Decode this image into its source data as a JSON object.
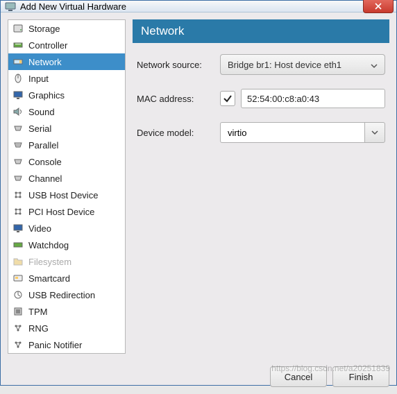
{
  "window": {
    "title": "Add New Virtual Hardware"
  },
  "sidebar": {
    "items": [
      {
        "label": "Storage",
        "icon": "storage-icon"
      },
      {
        "label": "Controller",
        "icon": "controller-icon"
      },
      {
        "label": "Network",
        "icon": "network-icon",
        "selected": true
      },
      {
        "label": "Input",
        "icon": "input-icon"
      },
      {
        "label": "Graphics",
        "icon": "graphics-icon"
      },
      {
        "label": "Sound",
        "icon": "sound-icon"
      },
      {
        "label": "Serial",
        "icon": "serial-icon"
      },
      {
        "label": "Parallel",
        "icon": "parallel-icon"
      },
      {
        "label": "Console",
        "icon": "console-icon"
      },
      {
        "label": "Channel",
        "icon": "channel-icon"
      },
      {
        "label": "USB Host Device",
        "icon": "usb-host-icon"
      },
      {
        "label": "PCI Host Device",
        "icon": "pci-host-icon"
      },
      {
        "label": "Video",
        "icon": "video-icon"
      },
      {
        "label": "Watchdog",
        "icon": "watchdog-icon"
      },
      {
        "label": "Filesystem",
        "icon": "filesystem-icon",
        "disabled": true
      },
      {
        "label": "Smartcard",
        "icon": "smartcard-icon"
      },
      {
        "label": "USB Redirection",
        "icon": "usb-redir-icon"
      },
      {
        "label": "TPM",
        "icon": "tpm-icon"
      },
      {
        "label": "RNG",
        "icon": "rng-icon"
      },
      {
        "label": "Panic Notifier",
        "icon": "panic-icon"
      }
    ]
  },
  "panel": {
    "title": "Network",
    "labels": {
      "source": "Network source:",
      "mac": "MAC address:",
      "model": "Device model:"
    },
    "values": {
      "source": "Bridge br1: Host device eth1",
      "mac": "52:54:00:c8:a0:43",
      "mac_enabled": true,
      "model": "virtio"
    }
  },
  "footer": {
    "cancel": "Cancel",
    "finish": "Finish"
  },
  "watermark": "https://blog.csdn.net/a20251839"
}
